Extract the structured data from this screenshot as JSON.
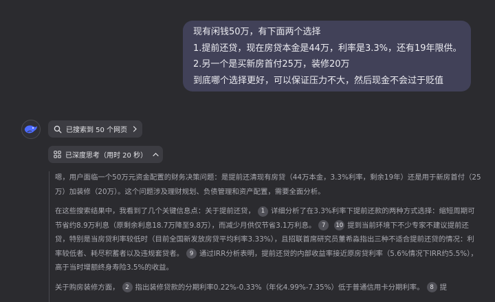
{
  "user_message": {
    "lines": [
      "现有闲钱50万，有下面两个选择",
      "1.提前还贷，现在房贷本金是44万，利率是3.3%，还有19年限供。",
      "2.另一个是买新房首付25万，装修20万",
      "到底哪个选择更好，可以保证压力不大，然后现金不会过于贬值"
    ]
  },
  "assistant": {
    "search_chip": {
      "label": "已搜索到 50 个网页",
      "icon": "search-globe-icon"
    },
    "think_chip": {
      "label": "已深度思考（用时 20 秒）",
      "icon": "deepthink-icon"
    },
    "paragraphs": {
      "p1": "嗯，用户面临一个50万元资金配置的财务决策问题：是提前还清现有房贷（44万本金，3.3%利率，剩余19年）还是用于新房首付（25万）加装修（20万）。这个问题涉及理财规划、负债管理和资产配置，需要全面分析。",
      "p2": {
        "t1": "在这些搜索结果中，我看到了几个关键信息点：关于提前还贷，",
        "c1": "1",
        "t2": "详细分析了在3.3%利率下提前还款的两种方式选择：缩短周期可节省约8.9万利息（原剩余利息18.7万降至9.8万），而减少月供仅节省3.1万利息。",
        "c2": "7",
        "c3": "10",
        "t3": "提到当前环境下不少专家不建议提前还贷，特别是当房贷利率较低时（目前全国新发放房贷平均利率3.33%），且招联首席研究员董希淼指出三种不适合提前还贷的情况：利率较低者、耗尽积蓄者以及违规套贷者。",
        "c4": "9",
        "t4": "通过IRR分析表明，提前还贷的内部收益率接近原房贷利率（5.6%情况下IRR约5.5%），高于当时增额终身寿险3.5%的收益。"
      },
      "p3": {
        "t1": "关于购房装修方面，",
        "c1": "2",
        "t2": "指出装修贷款的分期利率0.22%-0.33%（年化4.99%-7.35%）低于普通信用卡分期利率。",
        "c2": "8",
        "t3": "提"
      }
    }
  },
  "colors": {
    "background": "#2b2b2f",
    "user_bubble": "#414158",
    "chip": "#3c3c42",
    "citation_badge": "#515158",
    "brand": "#4d6bfe"
  }
}
